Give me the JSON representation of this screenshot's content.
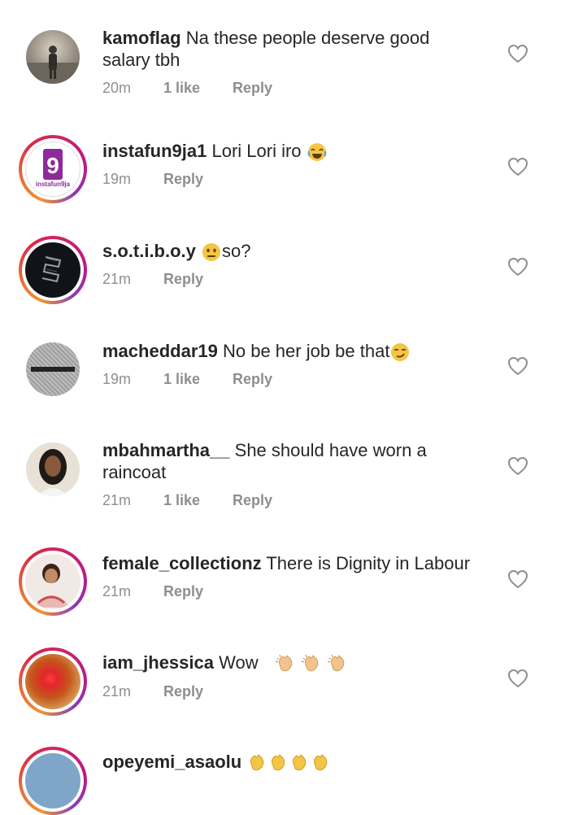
{
  "comments": [
    {
      "username": "kamoflag",
      "text": "Na these people deserve good",
      "text2": "salary tbh",
      "time": "20m",
      "likes": "1 like",
      "reply": "Reply"
    },
    {
      "username": "instafun9ja1",
      "text": "Lori Lori iro",
      "time": "19m",
      "likes": "",
      "reply": "Reply",
      "emoji": "laughing-emoji",
      "avatar_text": "instafun9ja"
    },
    {
      "username": "s.o.t.i.b.o.y",
      "text": "so?",
      "time": "21m",
      "likes": "",
      "reply": "Reply",
      "emoji": "neutral-face-emoji"
    },
    {
      "username": "macheddar19",
      "text": "No be her job be that",
      "time": "19m",
      "likes": "1 like",
      "reply": "Reply",
      "emoji": "smirk-emoji"
    },
    {
      "username": "mbahmartha__",
      "text": "She should have worn a",
      "text2": "raincoat",
      "time": "21m",
      "likes": "1 like",
      "reply": "Reply"
    },
    {
      "username": "female_collectionz",
      "text": "There is Dignity in Labour",
      "time": "21m",
      "likes": "",
      "reply": "Reply"
    },
    {
      "username": "iam_jhessica",
      "text": "Wow",
      "time": "21m",
      "likes": "",
      "reply": "Reply",
      "emoji": "clapping-hands-emoji"
    },
    {
      "username": "opeyemi_asaolu",
      "text": "",
      "emoji": "clapping-hands-emoji"
    }
  ],
  "colors": {
    "text": "#262626",
    "meta": "#8e8e8e",
    "heart": "#8e8e8e",
    "clap": "#f2c48d",
    "laugh": "#f4c542",
    "story_ring": "#dc2743"
  }
}
